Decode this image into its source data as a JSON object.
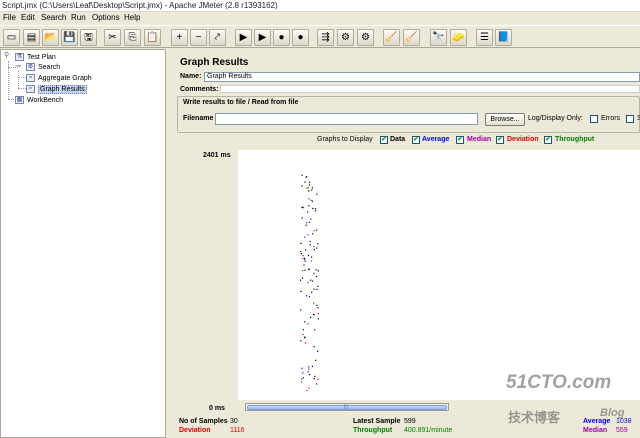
{
  "window_title": "Script.jmx (C:\\Users\\Leaf\\Desktop\\Script.jmx) - Apache JMeter (2.8 r1393162)",
  "menu": [
    "File",
    "Edit",
    "Search",
    "Run",
    "Options",
    "Help"
  ],
  "toolbar": [
    {
      "name": "new",
      "icon": "new-icon",
      "glyph": "▭"
    },
    {
      "name": "templates",
      "icon": "templates-icon",
      "glyph": "▤"
    },
    {
      "name": "open",
      "icon": "open-icon",
      "glyph": "📂"
    },
    {
      "name": "save",
      "icon": "save-icon",
      "glyph": "💾"
    },
    {
      "name": "save-test",
      "icon": "save-test-icon",
      "glyph": "🖫"
    },
    {
      "name": "cut",
      "icon": "cut-icon",
      "glyph": "✂"
    },
    {
      "name": "copy",
      "icon": "copy-icon",
      "glyph": "⎘"
    },
    {
      "name": "paste",
      "icon": "paste-icon",
      "glyph": "📋"
    },
    {
      "name": "expand",
      "icon": "expand-icon",
      "glyph": "+"
    },
    {
      "name": "collapse",
      "icon": "collapse-icon",
      "glyph": "−"
    },
    {
      "name": "toggle",
      "icon": "toggle-icon",
      "glyph": "⤤"
    },
    {
      "name": "start",
      "icon": "start-icon",
      "glyph": "▶"
    },
    {
      "name": "start-no-pause",
      "icon": "start-no-pause-icon",
      "glyph": "▶"
    },
    {
      "name": "stop",
      "icon": "stop-icon",
      "glyph": "●"
    },
    {
      "name": "shutdown",
      "icon": "shutdown-icon",
      "glyph": "●"
    },
    {
      "name": "remote-start",
      "icon": "remote-start-icon",
      "glyph": "⇶"
    },
    {
      "name": "remote-stop",
      "icon": "remote-stop-icon",
      "glyph": "⚙"
    },
    {
      "name": "remote-exit",
      "icon": "remote-exit-icon",
      "glyph": "⚙"
    },
    {
      "name": "clear",
      "icon": "clear-icon",
      "glyph": "🧹"
    },
    {
      "name": "clear-all",
      "icon": "clear-all-icon",
      "glyph": "🧹"
    },
    {
      "name": "search",
      "icon": "binoculars-icon",
      "glyph": "🔭"
    },
    {
      "name": "reset-search",
      "icon": "broom-icon",
      "glyph": "🧽"
    },
    {
      "name": "function-helper",
      "icon": "list-icon",
      "glyph": "☰"
    },
    {
      "name": "help",
      "icon": "help-book-icon",
      "glyph": "📘"
    }
  ],
  "tree": {
    "test_plan": "Test Plan",
    "search": "Search",
    "aggregate_graph": "Aggregate Graph",
    "graph_results": "Graph Results",
    "workbench": "WorkBench"
  },
  "panel": {
    "title": "Graph Results",
    "name_label": "Name:",
    "name_value": "Graph Results",
    "comments_label": "Comments:",
    "write_group_title": "Write results to file / Read from file",
    "filename_label": "Filename",
    "browse_label": "Browse...",
    "logdisplay_label": "Log/Display Only:",
    "errors_label": "Errors",
    "successes_label": "S",
    "graphs_to_display": "Graphs to Display"
  },
  "graph_toggles": [
    {
      "label": "Data",
      "color": "#000000",
      "checked": true
    },
    {
      "label": "Average",
      "color": "#0000ff",
      "checked": true
    },
    {
      "label": "Median",
      "color": "#a000a0",
      "checked": true
    },
    {
      "label": "Deviation",
      "color": "#e00000",
      "checked": true
    },
    {
      "label": "Throughput",
      "color": "#008000",
      "checked": true
    }
  ],
  "axis": {
    "top": "2401 ms",
    "bottom": "0 ms"
  },
  "stats": {
    "no_of_samples_label": "No of Samples",
    "no_of_samples": "30",
    "deviation_label": "Deviation",
    "deviation": "1116",
    "latest_sample_label": "Latest Sample",
    "latest_sample": "599",
    "throughput_label": "Throughput",
    "throughput": "400.891/minute",
    "average_label": "Average",
    "average": "1038",
    "median_label": "Median",
    "median": "559"
  },
  "watermark": {
    "line1": "51CTO.com",
    "line2": "技术博客",
    "line3": "Blog"
  },
  "colors": {
    "data": "#000000",
    "average": "#0000ff",
    "median": "#a000a0",
    "deviation": "#e00000",
    "throughput": "#008000"
  }
}
